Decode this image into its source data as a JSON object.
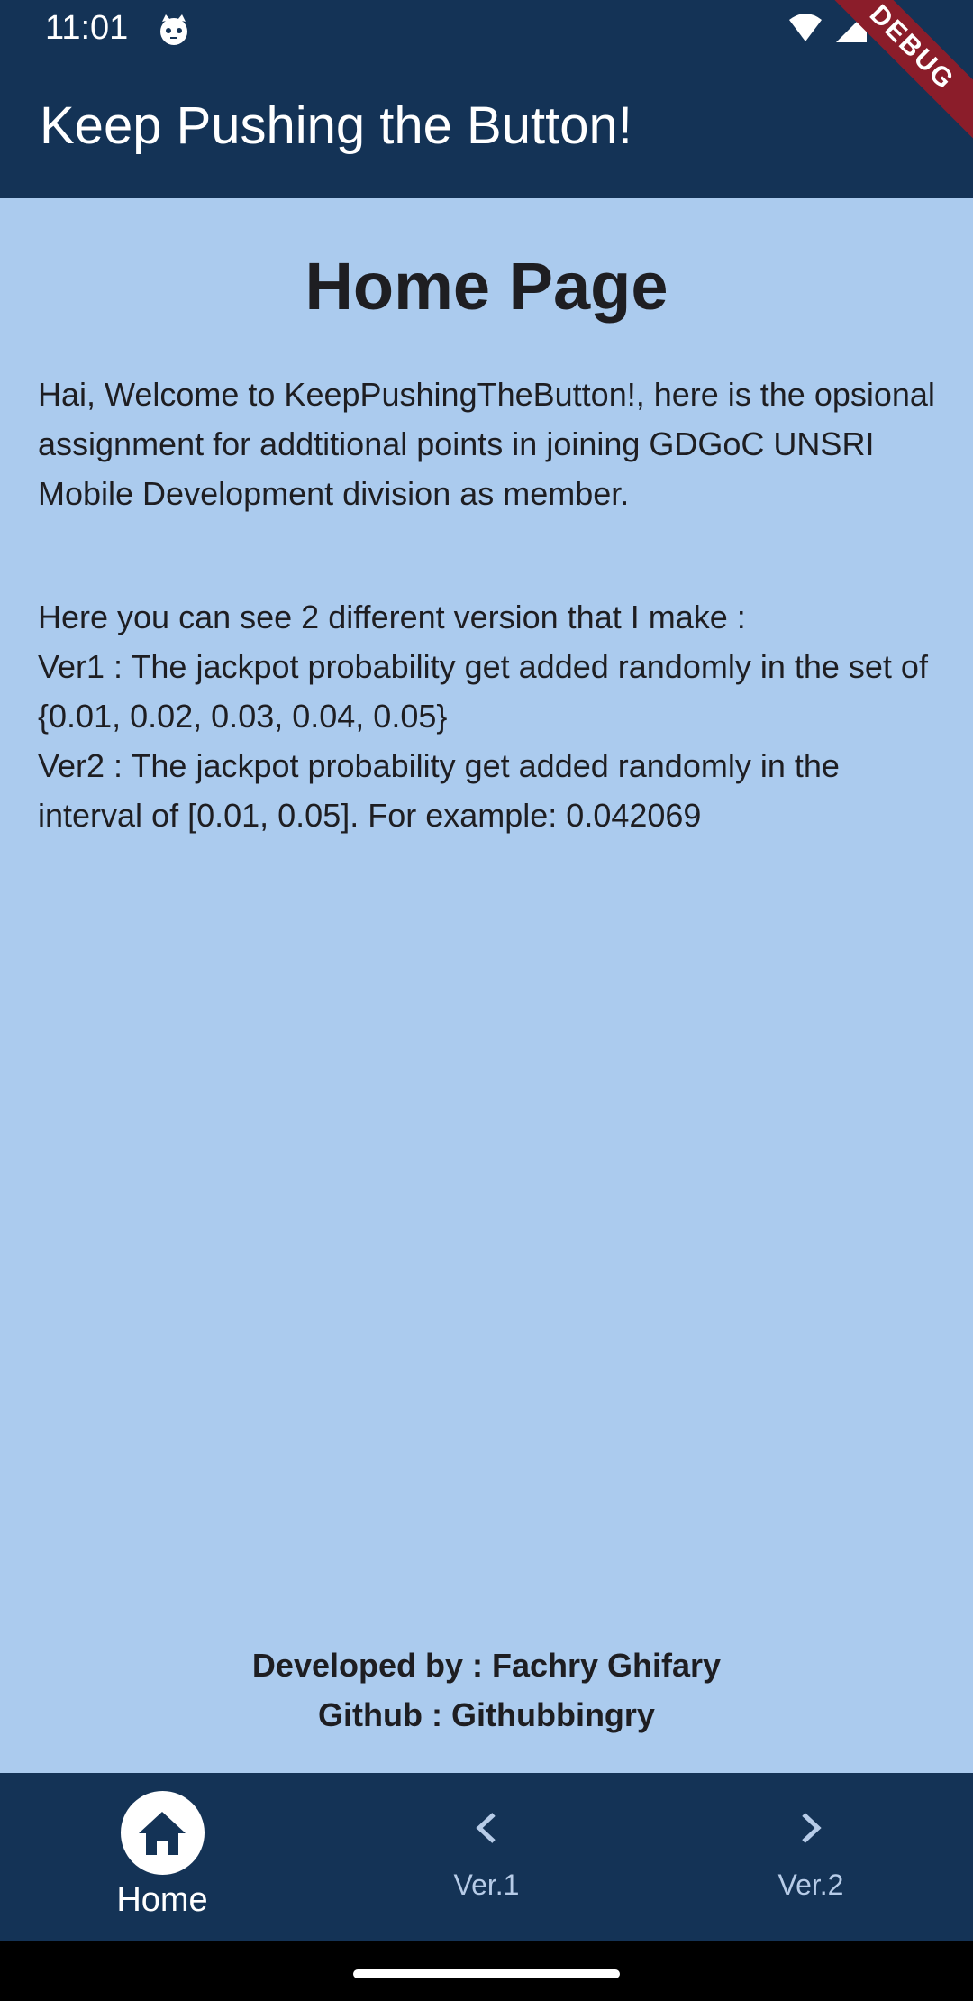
{
  "status_bar": {
    "time": "11:01"
  },
  "app_bar": {
    "title": "Keep Pushing the Button!",
    "debug_banner": "DEBUG"
  },
  "main": {
    "page_title": "Home Page",
    "paragraph_1": "Hai, Welcome to KeepPushingTheButton!, here is the opsional assignment for addtitional points in joining GDGoC UNSRI Mobile Development division as member.",
    "paragraph_2": "      Here you can see 2 different version that I make :\nVer1 : The jackpot probability get added randomly in the set of {0.01, 0.02, 0.03, 0.04, 0.05}\nVer2 : The jackpot probability get added randomly in the interval of [0.01, 0.05]. For example: 0.042069",
    "developer_line": "Developed by : Fachry Ghifary",
    "github_line": "Github : Githubbingry"
  },
  "bottom_nav": {
    "items": [
      {
        "label": "Home",
        "icon": "home-icon",
        "active": true
      },
      {
        "label": "Ver.1",
        "icon": "chevron-left-icon",
        "active": false
      },
      {
        "label": "Ver.2",
        "icon": "chevron-right-icon",
        "active": false
      }
    ]
  },
  "colors": {
    "primary_dark": "#143356",
    "background": "#abcbee",
    "text": "#1e1e22",
    "inactive_nav": "#b7cce8",
    "debug_ribbon": "#8b1d2a"
  }
}
